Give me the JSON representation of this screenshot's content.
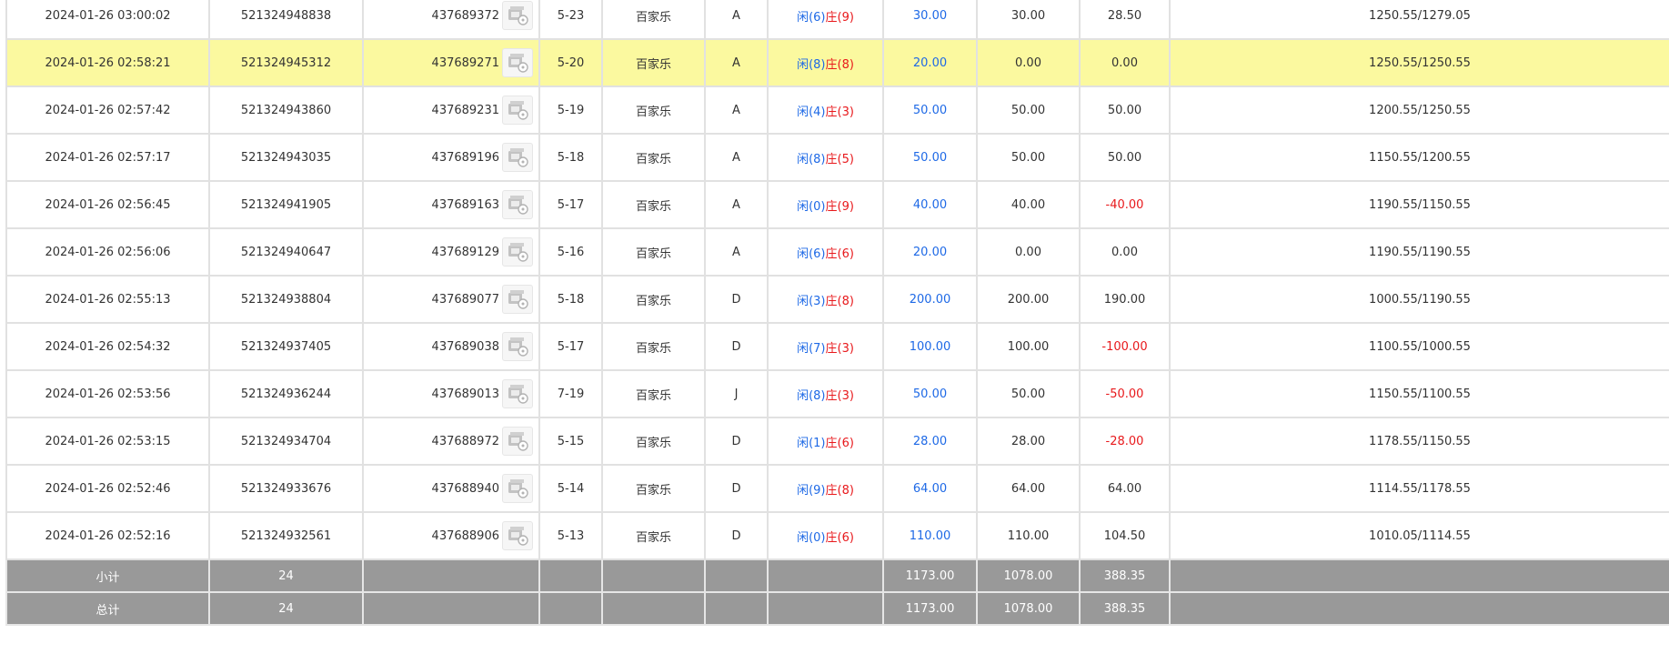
{
  "colors": {
    "highlight_row": "#fbf99f",
    "summary_bg": "#999999",
    "blue_text": "#1e69e6",
    "red_text": "#e8191c",
    "grid": "#e1e1e1"
  },
  "icons": {
    "result_icon": "card-table-icon"
  },
  "rows": [
    {
      "time": "2024-01-26 03:00:02",
      "order_no": "521324948838",
      "round_no": "437689372",
      "shoe": "5-23",
      "game": "百家乐",
      "table": "A",
      "player_label": "闲",
      "player_score": "(6)",
      "banker_label": "庄",
      "banker_score": "(9)",
      "bet": "30.00",
      "valid_bet": "30.00",
      "payout": "28.50",
      "payout_color": "normal",
      "balance": "1250.55/1279.05",
      "highlight": false
    },
    {
      "time": "2024-01-26 02:58:21",
      "order_no": "521324945312",
      "round_no": "437689271",
      "shoe": "5-20",
      "game": "百家乐",
      "table": "A",
      "player_label": "闲",
      "player_score": "(8)",
      "banker_label": "庄",
      "banker_score": "(8)",
      "bet": "20.00",
      "valid_bet": "0.00",
      "payout": "0.00",
      "payout_color": "normal",
      "balance": "1250.55/1250.55",
      "highlight": true
    },
    {
      "time": "2024-01-26 02:57:42",
      "order_no": "521324943860",
      "round_no": "437689231",
      "shoe": "5-19",
      "game": "百家乐",
      "table": "A",
      "player_label": "闲",
      "player_score": "(4)",
      "banker_label": "庄",
      "banker_score": "(3)",
      "bet": "50.00",
      "valid_bet": "50.00",
      "payout": "50.00",
      "payout_color": "normal",
      "balance": "1200.55/1250.55",
      "highlight": false
    },
    {
      "time": "2024-01-26 02:57:17",
      "order_no": "521324943035",
      "round_no": "437689196",
      "shoe": "5-18",
      "game": "百家乐",
      "table": "A",
      "player_label": "闲",
      "player_score": "(8)",
      "banker_label": "庄",
      "banker_score": "(5)",
      "bet": "50.00",
      "valid_bet": "50.00",
      "payout": "50.00",
      "payout_color": "normal",
      "balance": "1150.55/1200.55",
      "highlight": false
    },
    {
      "time": "2024-01-26 02:56:45",
      "order_no": "521324941905",
      "round_no": "437689163",
      "shoe": "5-17",
      "game": "百家乐",
      "table": "A",
      "player_label": "闲",
      "player_score": "(0)",
      "banker_label": "庄",
      "banker_score": "(9)",
      "bet": "40.00",
      "valid_bet": "40.00",
      "payout": "-40.00",
      "payout_color": "red",
      "balance": "1190.55/1150.55",
      "highlight": false
    },
    {
      "time": "2024-01-26 02:56:06",
      "order_no": "521324940647",
      "round_no": "437689129",
      "shoe": "5-16",
      "game": "百家乐",
      "table": "A",
      "player_label": "闲",
      "player_score": "(6)",
      "banker_label": "庄",
      "banker_score": "(6)",
      "bet": "20.00",
      "valid_bet": "0.00",
      "payout": "0.00",
      "payout_color": "normal",
      "balance": "1190.55/1190.55",
      "highlight": false
    },
    {
      "time": "2024-01-26 02:55:13",
      "order_no": "521324938804",
      "round_no": "437689077",
      "shoe": "5-18",
      "game": "百家乐",
      "table": "D",
      "player_label": "闲",
      "player_score": "(3)",
      "banker_label": "庄",
      "banker_score": "(8)",
      "bet": "200.00",
      "valid_bet": "200.00",
      "payout": "190.00",
      "payout_color": "normal",
      "balance": "1000.55/1190.55",
      "highlight": false
    },
    {
      "time": "2024-01-26 02:54:32",
      "order_no": "521324937405",
      "round_no": "437689038",
      "shoe": "5-17",
      "game": "百家乐",
      "table": "D",
      "player_label": "闲",
      "player_score": "(7)",
      "banker_label": "庄",
      "banker_score": "(3)",
      "bet": "100.00",
      "valid_bet": "100.00",
      "payout": "-100.00",
      "payout_color": "red",
      "balance": "1100.55/1000.55",
      "highlight": false
    },
    {
      "time": "2024-01-26 02:53:56",
      "order_no": "521324936244",
      "round_no": "437689013",
      "shoe": "7-19",
      "game": "百家乐",
      "table": "J",
      "player_label": "闲",
      "player_score": "(8)",
      "banker_label": "庄",
      "banker_score": "(3)",
      "bet": "50.00",
      "valid_bet": "50.00",
      "payout": "-50.00",
      "payout_color": "red",
      "balance": "1150.55/1100.55",
      "highlight": false
    },
    {
      "time": "2024-01-26 02:53:15",
      "order_no": "521324934704",
      "round_no": "437688972",
      "shoe": "5-15",
      "game": "百家乐",
      "table": "D",
      "player_label": "闲",
      "player_score": "(1)",
      "banker_label": "庄",
      "banker_score": "(6)",
      "bet": "28.00",
      "valid_bet": "28.00",
      "payout": "-28.00",
      "payout_color": "red",
      "balance": "1178.55/1150.55",
      "highlight": false
    },
    {
      "time": "2024-01-26 02:52:46",
      "order_no": "521324933676",
      "round_no": "437688940",
      "shoe": "5-14",
      "game": "百家乐",
      "table": "D",
      "player_label": "闲",
      "player_score": "(9)",
      "banker_label": "庄",
      "banker_score": "(8)",
      "bet": "64.00",
      "valid_bet": "64.00",
      "payout": "64.00",
      "payout_color": "normal",
      "balance": "1114.55/1178.55",
      "highlight": false
    },
    {
      "time": "2024-01-26 02:52:16",
      "order_no": "521324932561",
      "round_no": "437688906",
      "shoe": "5-13",
      "game": "百家乐",
      "table": "D",
      "player_label": "闲",
      "player_score": "(0)",
      "banker_label": "庄",
      "banker_score": "(6)",
      "bet": "110.00",
      "valid_bet": "110.00",
      "payout": "104.50",
      "payout_color": "normal",
      "balance": "1010.05/1114.55",
      "highlight": false
    }
  ],
  "subtotal": {
    "label": "小计",
    "count": "24",
    "bet": "1173.00",
    "valid_bet": "1078.00",
    "payout": "388.35"
  },
  "total": {
    "label": "总计",
    "count": "24",
    "bet": "1173.00",
    "valid_bet": "1078.00",
    "payout": "388.35"
  }
}
